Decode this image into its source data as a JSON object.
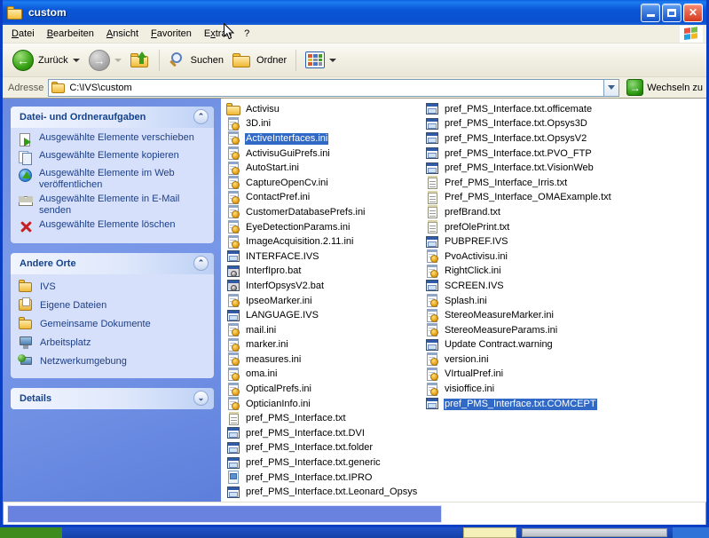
{
  "window": {
    "title": "custom",
    "title_icon": "folder-icon",
    "minimize_label": "Minimieren",
    "maximize_label": "Maximieren",
    "close_label": "Schließen"
  },
  "menu": {
    "items": [
      {
        "label": "Datei",
        "accel": "D"
      },
      {
        "label": "Bearbeiten",
        "accel": "B"
      },
      {
        "label": "Ansicht",
        "accel": "A"
      },
      {
        "label": "Favoriten",
        "accel": "F"
      },
      {
        "label": "Extras",
        "accel": "x"
      },
      {
        "label": "?",
        "accel": ""
      }
    ],
    "brand_icon": "windows-flag-icon"
  },
  "toolbar": {
    "back_label": "Zurück",
    "back_icon": "back-arrow-icon",
    "forward_icon": "forward-arrow-icon",
    "up_icon": "up-folder-icon",
    "search_label": "Suchen",
    "search_icon": "magnifier-icon",
    "folders_label": "Ordner",
    "folders_icon": "folder-icon",
    "views_icon": "views-grid-icon"
  },
  "address": {
    "label": "Adresse",
    "path": "C:\\IVS\\custom",
    "folder_icon": "folder-icon",
    "dropdown_icon": "chevron-down-icon",
    "go_label": "Wechseln zu",
    "go_icon": "green-arrow-icon"
  },
  "sidebar": {
    "panels": [
      {
        "title": "Datei- und Ordneraufgaben",
        "collapse_icon": "chevron-up-icon",
        "collapsed": false,
        "items": [
          {
            "label": "Ausgewählte Elemente verschieben",
            "icon": "move-icon"
          },
          {
            "label": "Ausgewählte Elemente kopieren",
            "icon": "copy-icon"
          },
          {
            "label": "Ausgewählte Elemente im Web veröffentlichen",
            "icon": "publish-web-icon"
          },
          {
            "label": "Ausgewählte Elemente in E-Mail senden",
            "icon": "email-icon"
          },
          {
            "label": "Ausgewählte Elemente löschen",
            "icon": "delete-x-icon"
          }
        ]
      },
      {
        "title": "Andere Orte",
        "collapse_icon": "chevron-up-icon",
        "collapsed": false,
        "items": [
          {
            "label": "IVS",
            "icon": "folder-icon"
          },
          {
            "label": "Eigene Dateien",
            "icon": "my-documents-icon"
          },
          {
            "label": "Gemeinsame Dokumente",
            "icon": "folder-icon"
          },
          {
            "label": "Arbeitsplatz",
            "icon": "my-computer-icon"
          },
          {
            "label": "Netzwerkumgebung",
            "icon": "network-icon"
          }
        ]
      },
      {
        "title": "Details",
        "collapse_icon": "chevron-down-icon",
        "collapsed": true,
        "items": []
      }
    ]
  },
  "files": {
    "column1": [
      {
        "name": "Activisu",
        "icon": "folder-icon",
        "selected": false
      },
      {
        "name": "3D.ini",
        "icon": "ini-file-icon",
        "selected": false
      },
      {
        "name": "ActiveInterfaces.ini",
        "icon": "ini-file-icon",
        "selected": true
      },
      {
        "name": "ActivisuGuiPrefs.ini",
        "icon": "ini-file-icon",
        "selected": false
      },
      {
        "name": "AutoStart.ini",
        "icon": "ini-file-icon",
        "selected": false
      },
      {
        "name": "CaptureOpenCv.ini",
        "icon": "ini-file-icon",
        "selected": false
      },
      {
        "name": "ContactPref.ini",
        "icon": "ini-file-icon",
        "selected": false
      },
      {
        "name": "CustomerDatabasePrefs.ini",
        "icon": "ini-file-icon",
        "selected": false
      },
      {
        "name": "EyeDetectionParams.ini",
        "icon": "ini-file-icon",
        "selected": false
      },
      {
        "name": "ImageAcquisition.2.11.ini",
        "icon": "ini-file-icon",
        "selected": false
      },
      {
        "name": "INTERFACE.IVS",
        "icon": "ivs-file-icon",
        "selected": false
      },
      {
        "name": "InterfIpro.bat",
        "icon": "bat-file-icon",
        "selected": false
      },
      {
        "name": "InterfOpsysV2.bat",
        "icon": "bat-file-icon",
        "selected": false
      },
      {
        "name": "IpseoMarker.ini",
        "icon": "ini-file-icon",
        "selected": false
      },
      {
        "name": "LANGUAGE.IVS",
        "icon": "ivs-file-icon",
        "selected": false
      },
      {
        "name": "mail.ini",
        "icon": "ini-file-icon",
        "selected": false
      },
      {
        "name": "marker.ini",
        "icon": "ini-file-icon",
        "selected": false
      },
      {
        "name": "measures.ini",
        "icon": "ini-file-icon",
        "selected": false
      },
      {
        "name": "oma.ini",
        "icon": "ini-file-icon",
        "selected": false
      },
      {
        "name": "OpticalPrefs.ini",
        "icon": "ini-file-icon",
        "selected": false
      },
      {
        "name": "OpticianInfo.ini",
        "icon": "ini-file-icon",
        "selected": false
      },
      {
        "name": "pref_PMS_Interface.txt",
        "icon": "txt-file-icon",
        "selected": false
      },
      {
        "name": "pref_PMS_Interface.txt.DVI",
        "icon": "ivs-file-icon",
        "selected": false
      },
      {
        "name": "pref_PMS_Interface.txt.folder",
        "icon": "ivs-file-icon",
        "selected": false
      },
      {
        "name": "pref_PMS_Interface.txt.generic",
        "icon": "ivs-file-icon",
        "selected": false
      },
      {
        "name": "pref_PMS_Interface.txt.IPRO",
        "icon": "ipro-file-icon",
        "selected": false
      },
      {
        "name": "pref_PMS_Interface.txt.Leonard_Opsys",
        "icon": "ivs-file-icon",
        "selected": false
      }
    ],
    "column2": [
      {
        "name": "pref_PMS_Interface.txt.officemate",
        "icon": "ivs-file-icon",
        "selected": false
      },
      {
        "name": "pref_PMS_Interface.txt.Opsys3D",
        "icon": "ivs-file-icon",
        "selected": false
      },
      {
        "name": "pref_PMS_Interface.txt.OpsysV2",
        "icon": "ivs-file-icon",
        "selected": false
      },
      {
        "name": "pref_PMS_Interface.txt.PVO_FTP",
        "icon": "ivs-file-icon",
        "selected": false
      },
      {
        "name": "pref_PMS_Interface.txt.VisionWeb",
        "icon": "ivs-file-icon",
        "selected": false
      },
      {
        "name": "Pref_PMS_Interface_Irris.txt",
        "icon": "txt-file-icon",
        "selected": false
      },
      {
        "name": "Pref_PMS_Interface_OMAExample.txt",
        "icon": "txt-file-icon",
        "selected": false
      },
      {
        "name": "prefBrand.txt",
        "icon": "txt-file-icon",
        "selected": false
      },
      {
        "name": "prefOlePrint.txt",
        "icon": "txt-file-icon",
        "selected": false
      },
      {
        "name": "PUBPREF.IVS",
        "icon": "ivs-file-icon",
        "selected": false
      },
      {
        "name": "PvoActivisu.ini",
        "icon": "ini-file-icon",
        "selected": false
      },
      {
        "name": "RightClick.ini",
        "icon": "ini-file-icon",
        "selected": false
      },
      {
        "name": "SCREEN.IVS",
        "icon": "ivs-file-icon",
        "selected": false
      },
      {
        "name": "Splash.ini",
        "icon": "ini-file-icon",
        "selected": false
      },
      {
        "name": "StereoMeasureMarker.ini",
        "icon": "ini-file-icon",
        "selected": false
      },
      {
        "name": "StereoMeasureParams.ini",
        "icon": "ini-file-icon",
        "selected": false
      },
      {
        "name": "Update Contract.warning",
        "icon": "ivs-file-icon",
        "selected": false
      },
      {
        "name": "version.ini",
        "icon": "ini-file-icon",
        "selected": false
      },
      {
        "name": "VIrtualPref.ini",
        "icon": "ini-file-icon",
        "selected": false
      },
      {
        "name": "visioffice.ini",
        "icon": "ini-file-icon",
        "selected": false
      },
      {
        "name": "pref_PMS_Interface.txt.COMCEPT",
        "icon": "ivs-file-icon",
        "selected": true
      }
    ]
  },
  "colors": {
    "title_blue": "#0054e3",
    "selection_blue": "#3169c6",
    "sidebar_blue": "#6f8fe4",
    "panel_body": "#d7e0fa",
    "panel_text": "#1d3f86",
    "toolbar_beige": "#f1efe2"
  }
}
